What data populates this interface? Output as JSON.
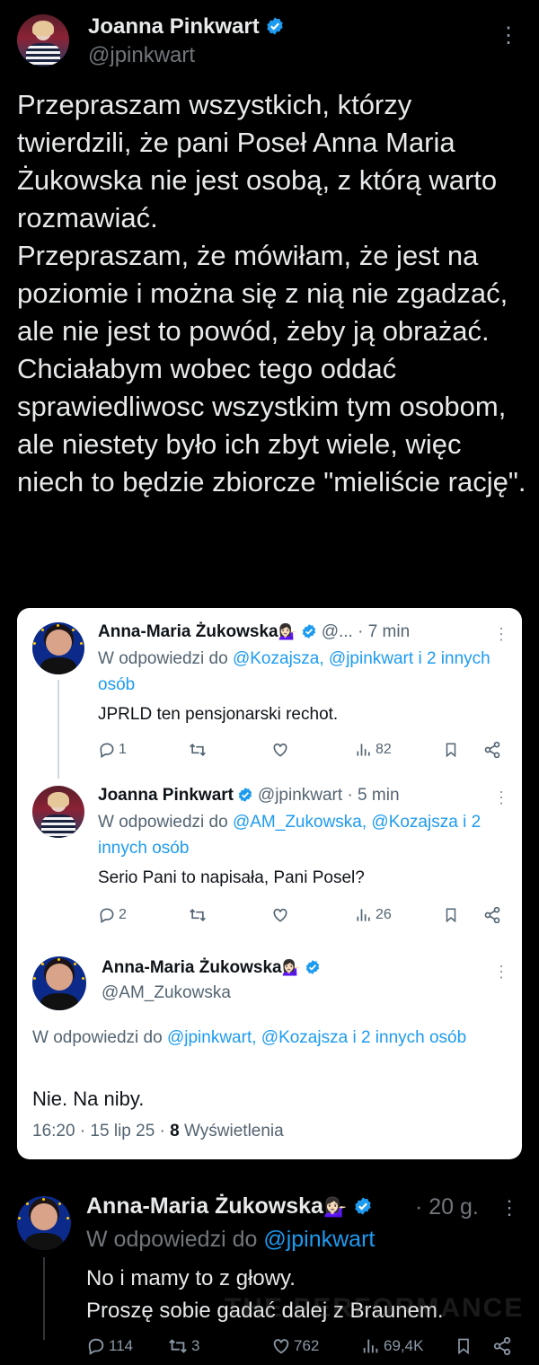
{
  "main_tweet": {
    "author_name": "Joanna Pinkwart",
    "handle": "@jpinkwart",
    "more_label": "⋮",
    "paragraphs": [
      "Przepraszam wszystkich, którzy twierdzili, że pani Poseł Anna Maria Żukowska nie jest osobą, z którą warto rozmawiać.",
      "Przepraszam, że mówiłam, że jest na poziomie i można się z nią nie zgadzać, ale nie jest to powód, żeby ją obrażać.",
      "Chciałabym wobec tego oddać sprawiedliwosc wszystkim tym osobom, ale niestety było ich zbyt wiele, więc niech to będzie zbiorcze \"mieliście rację\"."
    ]
  },
  "quoted_card": {
    "tweet1": {
      "author_name": "Anna-Maria Żukowska",
      "emoji": "💁🏻‍♀️",
      "handle_time": "@... · 7 min",
      "reply_prefix": "W odpowiedzi do ",
      "reply_targets": "@Kozajsza, @jpinkwart i 2 innych osób",
      "text": "JPRLD ten pensjonarski rechot.",
      "stats": {
        "replies": "1",
        "reposts": "",
        "likes": "",
        "views": "82"
      }
    },
    "tweet2": {
      "author_name": "Joanna Pinkwart",
      "handle_time": "@jpinkwart · 5 min",
      "reply_prefix": "W odpowiedzi do ",
      "reply_targets": "@AM_Zukowska, @Kozajsza i 2 innych osób",
      "text": "Serio Pani to napisała, Pani Posel?",
      "stats": {
        "replies": "2",
        "reposts": "",
        "likes": "",
        "views": "26"
      }
    },
    "tweet3": {
      "author_name": "Anna-Maria Żukowska",
      "emoji": "💁🏻‍♀️",
      "handle": "@AM_Zukowska",
      "reply_prefix": "W odpowiedzi do ",
      "reply_targets": "@jpinkwart, @Kozajsza i 2 innych osób",
      "text": "Nie. Na niby.",
      "timestamp": "16:20 · 15 lip 25 · ",
      "views_count": "8",
      "views_label": " Wyświetlenia"
    }
  },
  "bottom_reply": {
    "author_name": "Anna-Maria Żukowska",
    "emoji": "💁🏻‍♀️",
    "time": "· 20 g.",
    "reply_prefix": "W odpowiedzi do ",
    "reply_target": "@jpinkwart",
    "lines": [
      "No i mamy to z głowy.",
      "Proszę sobie gadać dalej z Braunem."
    ],
    "watermark": "THE PERFORMANCE",
    "stats": {
      "replies": "114",
      "reposts": "3",
      "likes": "762",
      "views": "69,4K"
    }
  },
  "colors": {
    "background": "#000000",
    "link": "#1d9bf0",
    "verified": "#1d9bf0",
    "card": "#ffffff"
  },
  "icons": [
    "verified-badge-icon",
    "reply-icon",
    "repost-icon",
    "like-icon",
    "views-icon",
    "bookmark-icon",
    "share-icon",
    "more-icon"
  ]
}
